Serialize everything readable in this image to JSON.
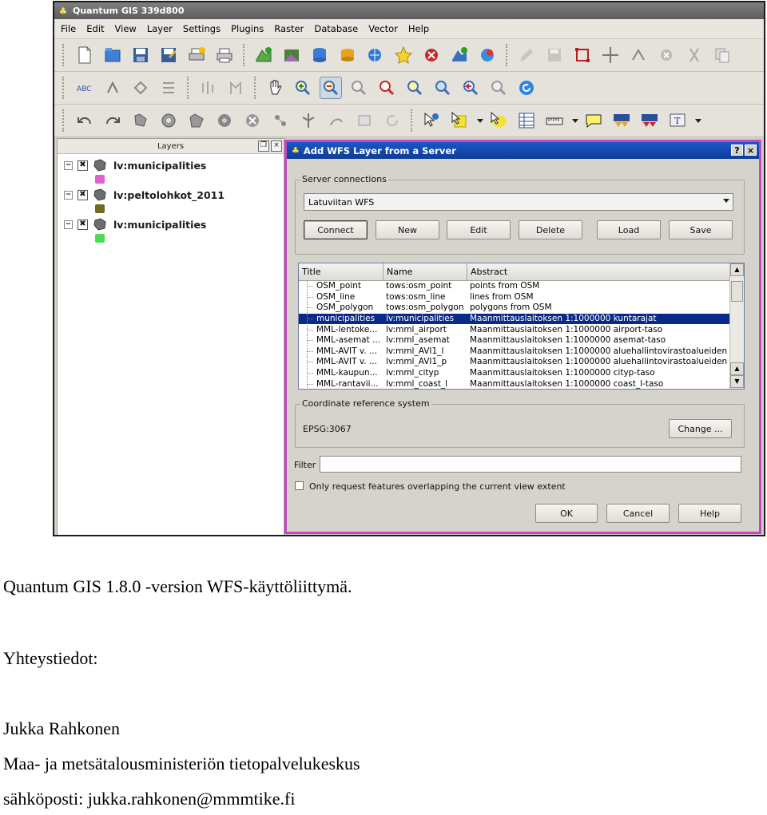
{
  "window": {
    "title": "Quantum GIS 339d800"
  },
  "menubar": {
    "items": [
      "File",
      "Edit",
      "View",
      "Layer",
      "Settings",
      "Plugins",
      "Raster",
      "Database",
      "Vector",
      "Help"
    ]
  },
  "layers_panel": {
    "title": "Layers",
    "layers": [
      {
        "name": "lv:municipalities",
        "checked": true,
        "swatch_color": "#e25fd0"
      },
      {
        "name": "lv:peltolohkot_2011",
        "checked": true,
        "swatch_color": "#6e6a26"
      },
      {
        "name": "lv:municipalities",
        "checked": true,
        "swatch_color": "#4ddb58"
      }
    ]
  },
  "dialog": {
    "title": "Add WFS Layer from a Server",
    "title_buttons": [
      "?",
      "×"
    ],
    "server_connections": {
      "label": "Server connections",
      "selected": "Latuviitan WFS",
      "buttons": [
        "Connect",
        "New",
        "Edit",
        "Delete",
        "Load",
        "Save"
      ]
    },
    "table": {
      "columns": [
        "Title",
        "Name",
        "Abstract"
      ],
      "rows": [
        {
          "title": "OSM_point",
          "name": "tows:osm_point",
          "abstract": "points from OSM"
        },
        {
          "title": "OSM_line",
          "name": "tows:osm_line",
          "abstract": "lines from OSM"
        },
        {
          "title": "OSM_polygon",
          "name": "tows:osm_polygon",
          "abstract": "polygons from OSM"
        },
        {
          "title": "municipalities",
          "name": "lv:municipalities",
          "abstract": "Maanmittauslaitoksen 1:1000000 kuntarajat",
          "selected": true
        },
        {
          "title": "MML-lentoke...",
          "name": "lv:mml_airport",
          "abstract": "Maanmittauslaitoksen 1:1000000 airport-taso"
        },
        {
          "title": "MML-asemat ...",
          "name": "lv:mml_asemat",
          "abstract": "Maanmittauslaitoksen 1:1000000 asemat-taso"
        },
        {
          "title": "MML-AVIT v. ...",
          "name": "lv:mml_AVI1_l",
          "abstract": "Maanmittauslaitoksen 1:1000000 aluehallintovirastoalueiden ..."
        },
        {
          "title": "MML-AVIT v. ...",
          "name": "lv:mml_AVI1_p",
          "abstract": "Maanmittauslaitoksen 1:1000000 aluehallintovirastoalueiden ..."
        },
        {
          "title": "MML-kaupun...",
          "name": "lv:mml_cityp",
          "abstract": "Maanmittauslaitoksen 1:1000000 cityp-taso"
        },
        {
          "title": "MML-rantavii...",
          "name": "lv:mml_coast_l",
          "abstract": "Maanmittauslaitoksen 1:1000000 coast_l-taso"
        }
      ]
    },
    "crs": {
      "label": "Coordinate reference system",
      "value": "EPSG:3067",
      "change_button": "Change ..."
    },
    "filter": {
      "label": "Filter",
      "value": ""
    },
    "extent_checkbox": {
      "label": "Only request features overlapping the current view extent",
      "checked": false
    },
    "footer_buttons": [
      "OK",
      "Cancel",
      "Help"
    ]
  },
  "document": {
    "caption": "Quantum GIS 1.8.0 -version WFS-käyttöliittymä.",
    "contact_heading": "Yhteystiedot:",
    "contact_name": "Jukka Rahkonen",
    "contact_org": "Maa- ja metsätalousministeriön tietopalvelukeskus",
    "contact_email": "sähköposti: jukka.rahkonen@mmmtike.fi"
  }
}
